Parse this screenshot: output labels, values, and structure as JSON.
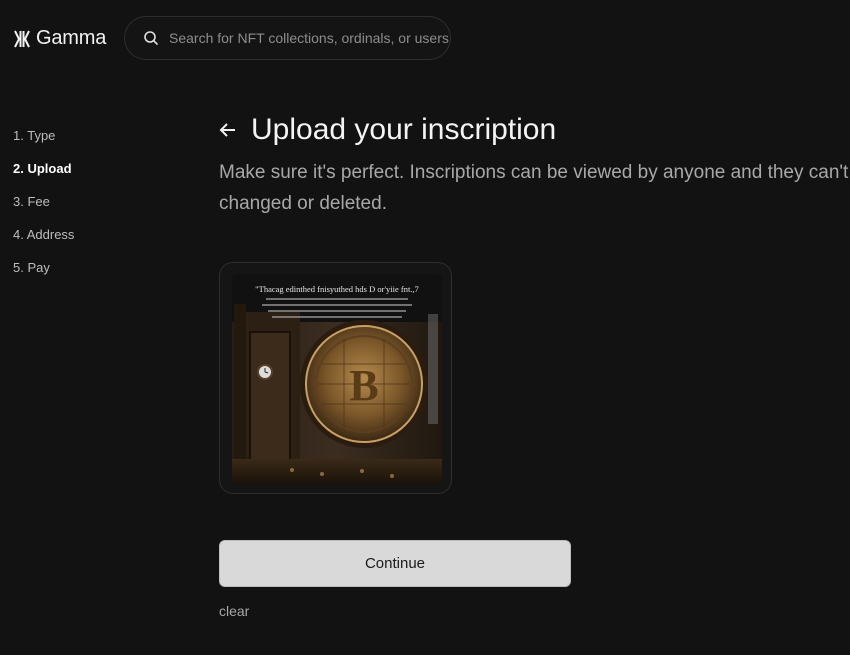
{
  "header": {
    "brand": "Gamma",
    "search": {
      "placeholder": "Search for NFT collections, ordinals, or users",
      "value": ""
    }
  },
  "steps": {
    "items": [
      {
        "label": "1. Type",
        "active": false
      },
      {
        "label": "2. Upload",
        "active": true
      },
      {
        "label": "3. Fee",
        "active": false
      },
      {
        "label": "4. Address",
        "active": false
      },
      {
        "label": "5. Pay",
        "active": false
      }
    ]
  },
  "main": {
    "title": "Upload your inscription",
    "subtitle": "Make sure it's perfect. Inscriptions can be viewed by anyone and they can't be changed or deleted.",
    "preview": {
      "caption_line": "\"Thacag edinthed fnisyuthed hds D or'yiie fnt.,7"
    },
    "continue_label": "Continue",
    "clear_label": "clear"
  },
  "colors": {
    "background": "#121212",
    "button_bg": "#d9d9d9",
    "muted_text": "#a8a8a8"
  }
}
